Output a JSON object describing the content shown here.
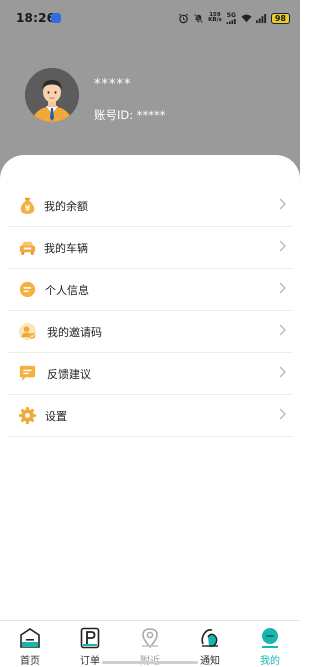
{
  "status_bar": {
    "time": "18:26",
    "net_speed_top": "159",
    "net_speed_bottom": "KB/s",
    "signal_label": "5G",
    "battery": "98"
  },
  "profile": {
    "name": "*****",
    "account_id": "账号ID: *****"
  },
  "menu": {
    "items": [
      {
        "label": "我的余额",
        "icon": "money-bag-icon"
      },
      {
        "label": "我的车辆",
        "icon": "car-icon"
      },
      {
        "label": "个人信息",
        "icon": "personal-info-icon"
      },
      {
        "label": "我的邀请码",
        "icon": "invite-code-icon"
      },
      {
        "label": "反馈建议",
        "icon": "feedback-icon"
      },
      {
        "label": "设置",
        "icon": "settings-gear-icon"
      }
    ]
  },
  "tabbar": {
    "tabs": [
      {
        "label": "首页",
        "icon": "home-icon"
      },
      {
        "label": "订单",
        "icon": "order-p-icon"
      },
      {
        "label": "附近",
        "icon": "location-pin-icon"
      },
      {
        "label": "通知",
        "icon": "notification-icon"
      },
      {
        "label": "我的",
        "icon": "profile-icon"
      }
    ],
    "active_index": 4
  },
  "colors": {
    "header_bg": "#9a9a9a",
    "accent_orange": "#f2a93b",
    "active_tab": "#19b6b0"
  }
}
